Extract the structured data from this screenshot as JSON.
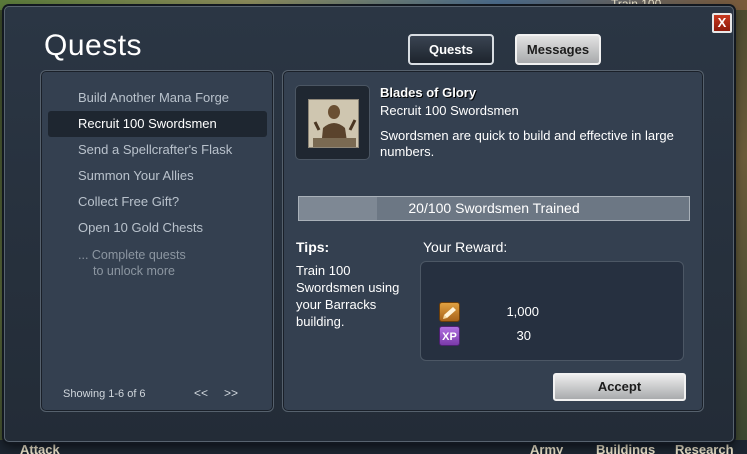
{
  "background": {
    "top_text": "Train 100",
    "bottom_labels": [
      "Attack",
      "Army",
      "Buildings",
      "Research"
    ]
  },
  "dialog": {
    "title": "Quests",
    "close_label": "X",
    "tabs": [
      {
        "label": "Quests",
        "active": true
      },
      {
        "label": "Messages",
        "active": false
      }
    ]
  },
  "quest_list": {
    "items": [
      {
        "label": "Build Another Mana Forge",
        "selected": false
      },
      {
        "label": "Recruit 100 Swordsmen",
        "selected": true
      },
      {
        "label": "Send a Spellcrafter's Flask",
        "selected": false
      },
      {
        "label": "Summon Your Allies",
        "selected": false
      },
      {
        "label": "Collect Free Gift?",
        "selected": false
      },
      {
        "label": "Open 10 Gold Chests",
        "selected": false
      }
    ],
    "locked_note_line1": "... Complete quests",
    "locked_note_line2": "to unlock more",
    "showing": "Showing 1-6 of 6",
    "prev_label": "<<",
    "next_label": ">>"
  },
  "quest_detail": {
    "name": "Blades of Glory",
    "subtitle": "Recruit 100 Swordsmen",
    "description": "Swordsmen are quick to build and effective in large numbers.",
    "progress_current": 20,
    "progress_total": 100,
    "progress_text": "20/100 Swordsmen Trained",
    "tips_heading": "Tips:",
    "tips_text": "Train 100 Swordsmen using your Barracks building.",
    "reward_heading": "Your Reward:",
    "rewards": [
      {
        "icon": "resource-icon",
        "value": "1,000"
      },
      {
        "icon": "xp-icon",
        "icon_text": "XP",
        "value": "30"
      }
    ],
    "accept_label": "Accept"
  },
  "colors": {
    "panel": "#344050",
    "dialog": "#2b3644",
    "xp_purple": "#9a52cc",
    "resource_orange": "#d08a30"
  }
}
